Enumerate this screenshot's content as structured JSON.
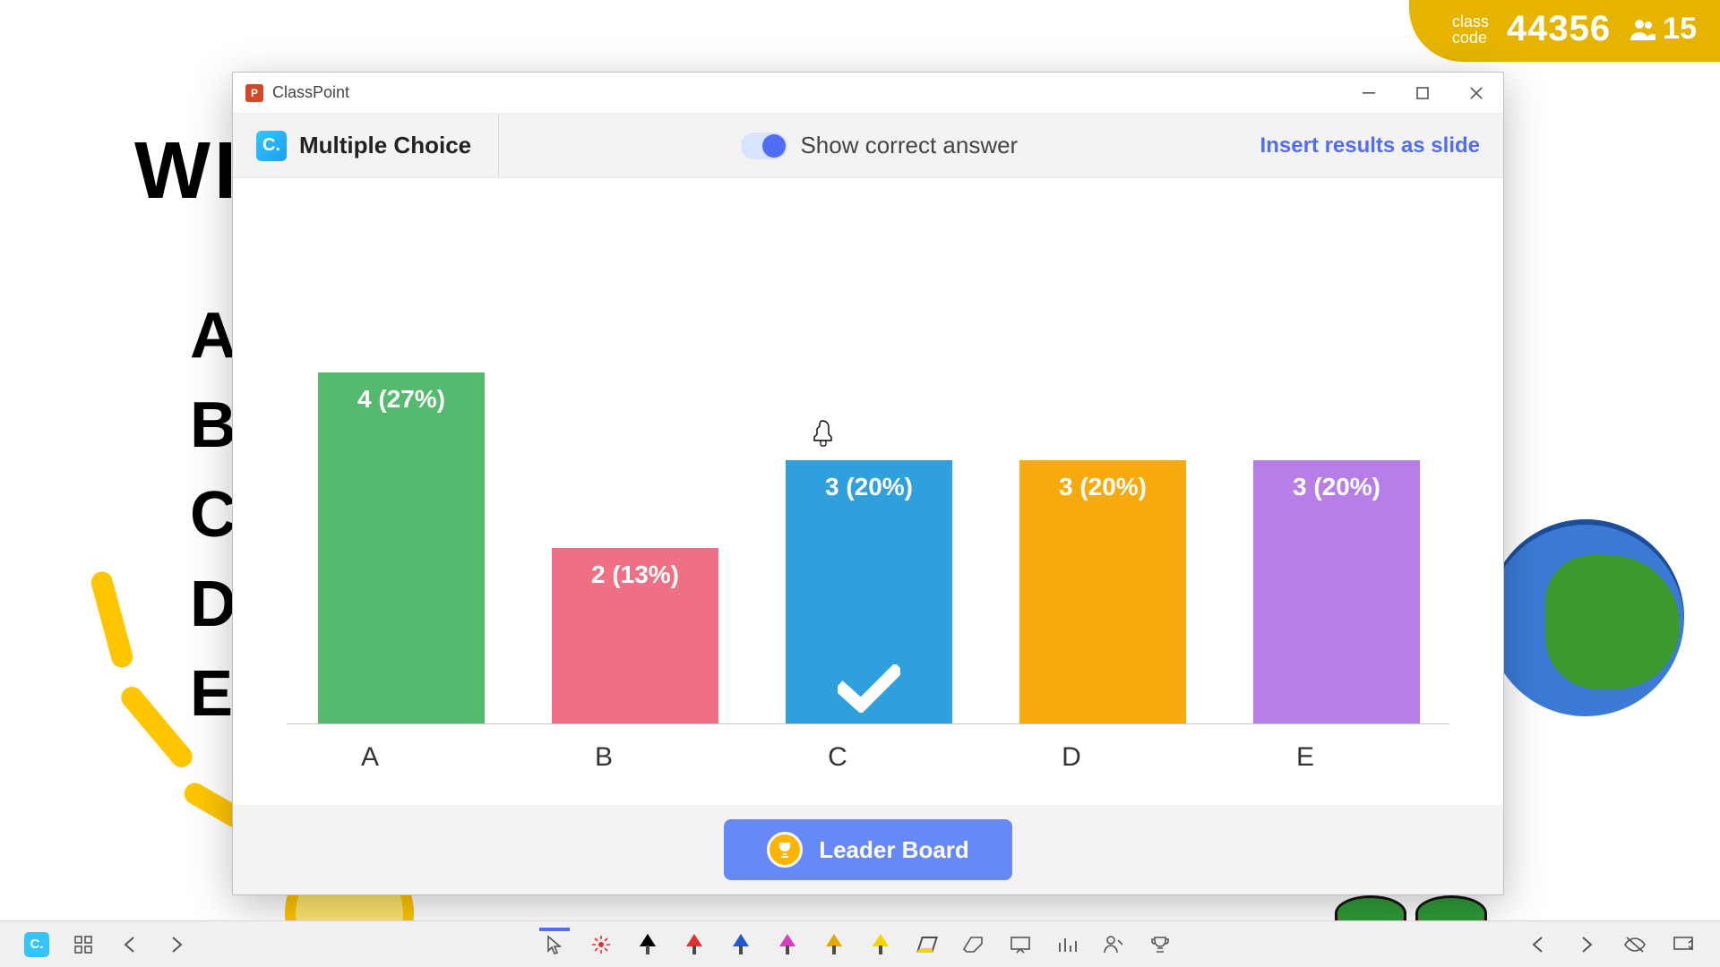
{
  "class_code": {
    "label_top": "class",
    "label_bottom": "code",
    "code": "44356",
    "student_count": "15"
  },
  "bg": {
    "title": "WI",
    "options": [
      "A",
      "B",
      "C",
      "D",
      "E"
    ]
  },
  "window": {
    "title": "ClassPoint",
    "header": {
      "tool_name": "Multiple Choice",
      "show_answer_label": "Show correct answer",
      "insert_label": "Insert results as slide"
    },
    "leader_board_label": "Leader Board"
  },
  "chart_data": {
    "type": "bar",
    "title": "",
    "xlabel": "",
    "ylabel": "",
    "ylim": [
      0,
      5
    ],
    "categories": [
      "A",
      "B",
      "C",
      "D",
      "E"
    ],
    "values": [
      4,
      2,
      3,
      3,
      3
    ],
    "percentages": [
      27,
      13,
      20,
      20,
      20
    ],
    "display_values": [
      "4 (27%)",
      "2 (13%)",
      "3 (20%)",
      "3 (20%)",
      "3 (20%)"
    ],
    "colors": [
      "#55b96e",
      "#ef6f84",
      "#2fa0dc",
      "#f6aa0d",
      "#b77ee8"
    ],
    "correct_index": 2
  },
  "toolbar": {
    "pen_colors": [
      "#000000",
      "#e03131",
      "#2159d6",
      "#d63fbf",
      "#e6a700",
      "#f5d400"
    ],
    "tools_right": [
      "back",
      "forward",
      "eye-off",
      "screen"
    ]
  }
}
